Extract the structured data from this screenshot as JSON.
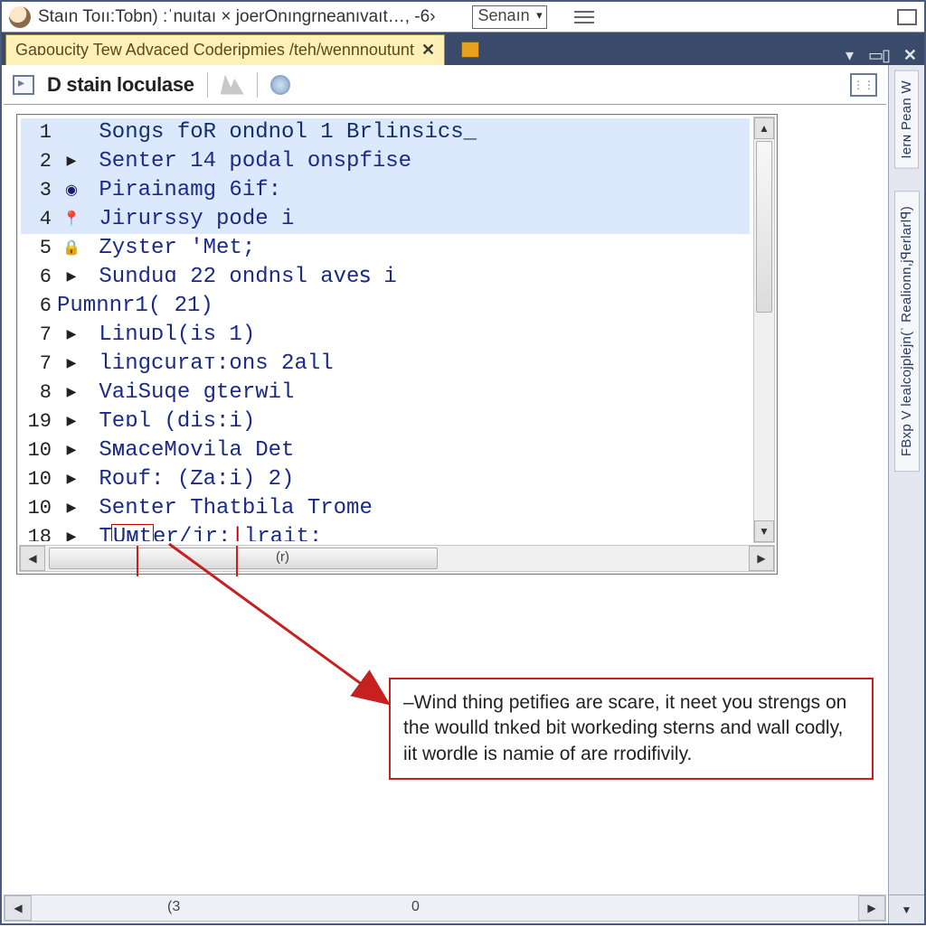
{
  "top": {
    "title": "Staın Toıı:Tobn) :ˈnuıtaı × joerOnıngrneanıvaıt…, -6›",
    "select": "Senaın"
  },
  "tab": {
    "label": "Gaɒoucity Tew Advaced Coderipmies /teh/wennnoutunt"
  },
  "subbar": {
    "crumb": "D stain loculase"
  },
  "editor": {
    "hmark": "(r)",
    "lines": [
      {
        "n": "1",
        "icon": "",
        "text": "Songs foR ondnol 1 Brlinsics_",
        "sel": true
      },
      {
        "n": "2",
        "icon": "tri",
        "text": "Senter 14 podal onspfise",
        "sel": true
      },
      {
        "n": "3",
        "icon": "dot",
        "text": "Pirainamg 6if:",
        "sel": true
      },
      {
        "n": "4",
        "icon": "pin",
        "text": "Jirurssy pode i",
        "sel": true
      },
      {
        "n": "5",
        "icon": "lock",
        "text": "Zyster 'Met;",
        "sel": false
      },
      {
        "n": "6",
        "icon": "tri",
        "text": "Sunduɑ 22 ondnsl aveꜱ i",
        "sel": false
      },
      {
        "n": "6",
        "icon": "",
        "text": "Pumnnr1( 21)",
        "sel": false,
        "outdent": true
      },
      {
        "n": "7",
        "icon": "tri",
        "text": "Linuᴅl(is 1)",
        "sel": false
      },
      {
        "n": "7",
        "icon": "tri",
        "text": "lingcuraᴛ:ons 2all",
        "sel": false
      },
      {
        "n": "8",
        "icon": "tri",
        "text": "VaiSuqe gterwil",
        "sel": false
      },
      {
        "n": "19",
        "icon": "tri",
        "text": "Teɒl (dis:i)",
        "sel": false
      },
      {
        "n": "10",
        "icon": "tri",
        "text": "SᴍaceMovila Det",
        "sel": false
      },
      {
        "n": "10",
        "icon": "tri",
        "text": "Rouf: (Za:i) 2)",
        "sel": false
      },
      {
        "n": "10",
        "icon": "tri",
        "text": "Senter Thatbila Trome",
        "sel": false
      },
      {
        "n": "18",
        "icon": "tri",
        "text": "TUnter/jr:lrait:",
        "sel": false,
        "boxed": true
      }
    ]
  },
  "rail": {
    "top": "Ierɴ  Pean W",
    "mid": "FBxp V lealcojplejn(ˈ Realionn,jꟼerlarlꟼ)"
  },
  "annotation": "–Wind thing petifieɢ are sᴄare, it neet you strengs on the woulld tnked bit workeding sterns and wall codly, iit wordle is namie of are rrodifivily.",
  "outer": {
    "m1": "(3",
    "m2": "0"
  },
  "colors": {
    "tabbar": "#3a4a6a",
    "activetab": "#fff0b8",
    "selrow": "#dce8fb",
    "code": "#1a2a8a",
    "annot_border": "#c62020"
  }
}
